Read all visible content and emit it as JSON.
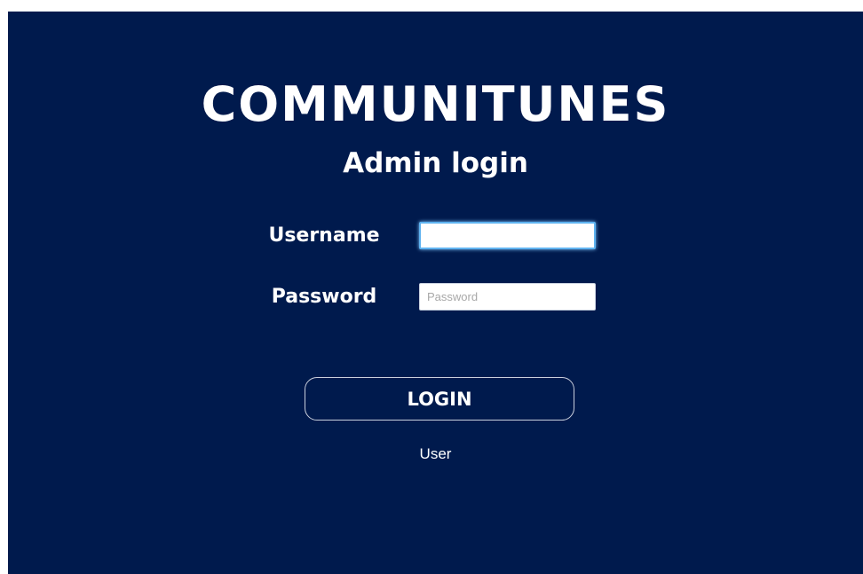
{
  "header": {
    "app_title": "COMMUNITUNES",
    "subtitle": "Admin login"
  },
  "form": {
    "username": {
      "label": "Username",
      "value": "",
      "placeholder": ""
    },
    "password": {
      "label": "Password",
      "value": "",
      "placeholder": "Password"
    },
    "login_label": "LOGIN",
    "user_link": "User"
  },
  "colors": {
    "background": "#001a4d",
    "text": "#ffffff",
    "focus_ring": "#5fb3f0"
  }
}
